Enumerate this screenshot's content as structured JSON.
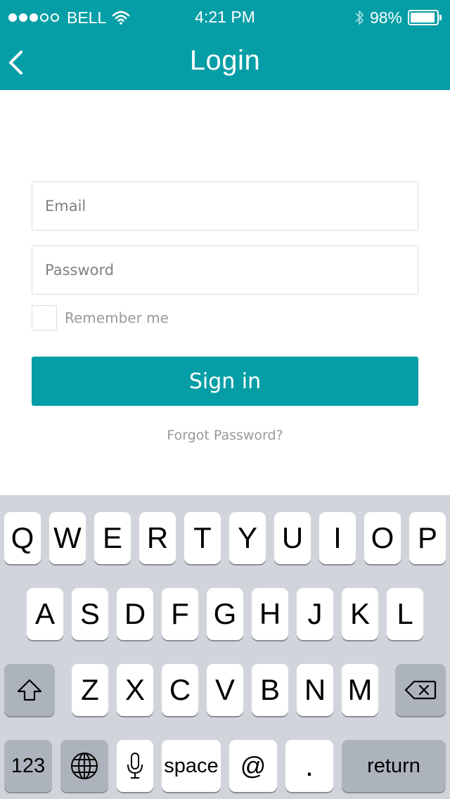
{
  "status_bar": {
    "carrier": "BELL",
    "signal_filled": 3,
    "signal_total": 5,
    "time": "4:21 PM",
    "battery": "98%"
  },
  "nav": {
    "title": "Login",
    "back_icon": "chevron-left-icon"
  },
  "form": {
    "email_placeholder": "Email",
    "email_value": "",
    "password_placeholder": "Password",
    "password_value": "",
    "remember_label": "Remember me",
    "remember_checked": false,
    "signin_label": "Sign in",
    "forgot_label": "Forgot Password?"
  },
  "keyboard": {
    "row1": [
      "Q",
      "W",
      "E",
      "R",
      "T",
      "Y",
      "U",
      "I",
      "O",
      "P"
    ],
    "row2": [
      "A",
      "S",
      "D",
      "F",
      "G",
      "H",
      "J",
      "K",
      "L"
    ],
    "row3": [
      "Z",
      "X",
      "C",
      "V",
      "B",
      "N",
      "M"
    ],
    "numbers_label": "123",
    "space_label": "space",
    "at_label": "@",
    "period_label": ".",
    "return_label": "return",
    "shift_icon": "shift-icon",
    "backspace_icon": "backspace-icon",
    "globe_icon": "globe-icon",
    "mic_icon": "microphone-icon"
  },
  "colors": {
    "accent": "#069ea6",
    "keyboard_bg": "#d1d5db",
    "key_dark": "#acb3bc"
  }
}
